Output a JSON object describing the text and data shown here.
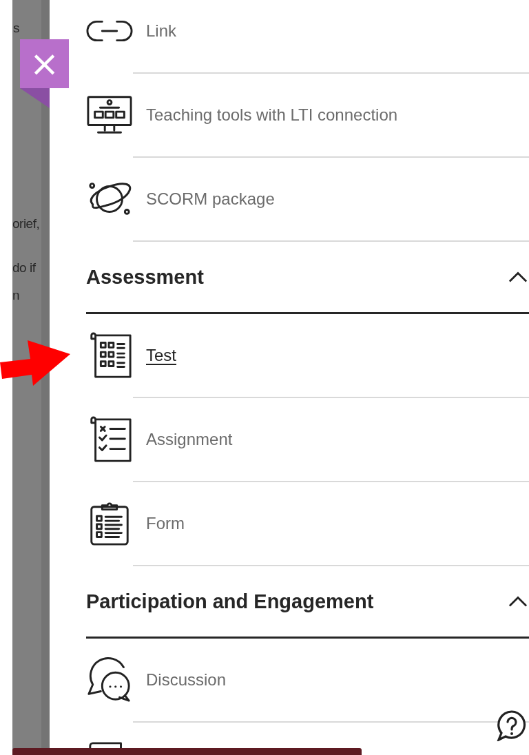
{
  "background_page": {
    "texts": [
      "s",
      "orief,",
      "do if",
      "n"
    ]
  },
  "close_button": {
    "label": "×"
  },
  "groups": [
    {
      "items": [
        {
          "label": "Link",
          "selected": false
        },
        {
          "label": "Teaching tools with LTI connection",
          "selected": false
        },
        {
          "label": "SCORM package",
          "selected": false
        }
      ]
    },
    {
      "heading": "Assessment",
      "expanded": true,
      "items": [
        {
          "label": "Test",
          "selected": true
        },
        {
          "label": "Assignment",
          "selected": false
        },
        {
          "label": "Form",
          "selected": false
        }
      ]
    },
    {
      "heading": "Participation and Engagement",
      "expanded": true,
      "items": [
        {
          "label": "Discussion",
          "selected": false
        },
        {
          "selected": false
        }
      ]
    }
  ]
}
